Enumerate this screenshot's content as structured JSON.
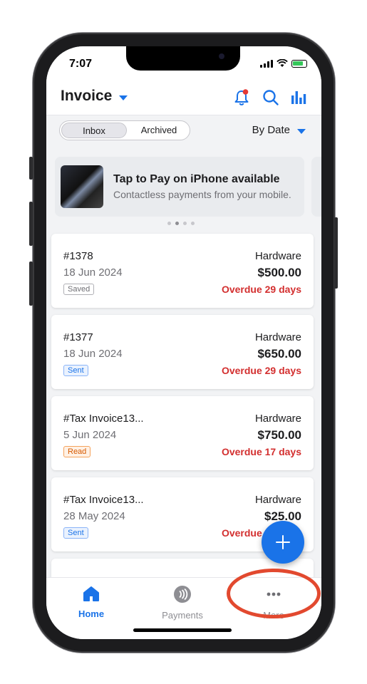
{
  "status_bar": {
    "time": "7:07"
  },
  "header": {
    "title": "Invoice"
  },
  "filter": {
    "tabs": [
      {
        "label": "Inbox",
        "active": true
      },
      {
        "label": "Archived",
        "active": false
      }
    ],
    "sort_label": "By Date"
  },
  "banner": {
    "title": "Tap to Pay on iPhone available",
    "subtitle": "Contactless payments from your mobile."
  },
  "invoices": [
    {
      "number": "#1378",
      "date": "18 Jun 2024",
      "status": "Saved",
      "customer": "Hardware",
      "amount": "$500.00",
      "overdue": "Overdue 29 days"
    },
    {
      "number": "#1377",
      "date": "18 Jun 2024",
      "status": "Sent",
      "customer": "Hardware",
      "amount": "$650.00",
      "overdue": "Overdue 29 days"
    },
    {
      "number": "#Tax Invoice13...",
      "date": "5 Jun 2024",
      "status": "Read",
      "customer": "Hardware",
      "amount": "$750.00",
      "overdue": "Overdue 17 days"
    },
    {
      "number": "#Tax Invoice13...",
      "date": "28 May 2024",
      "status": "Sent",
      "customer": "Hardware",
      "amount": "$25.00",
      "overdue": "Overdue 18 days"
    }
  ],
  "tabbar": {
    "items": [
      {
        "label": "Home",
        "icon": "home-icon",
        "active": true
      },
      {
        "label": "Payments",
        "icon": "payments-icon",
        "active": false
      },
      {
        "label": "More",
        "icon": "more-icon",
        "active": false
      }
    ]
  },
  "colors": {
    "accent": "#1a73e8",
    "overdue": "#d32f2f",
    "highlight": "#e2492f"
  }
}
